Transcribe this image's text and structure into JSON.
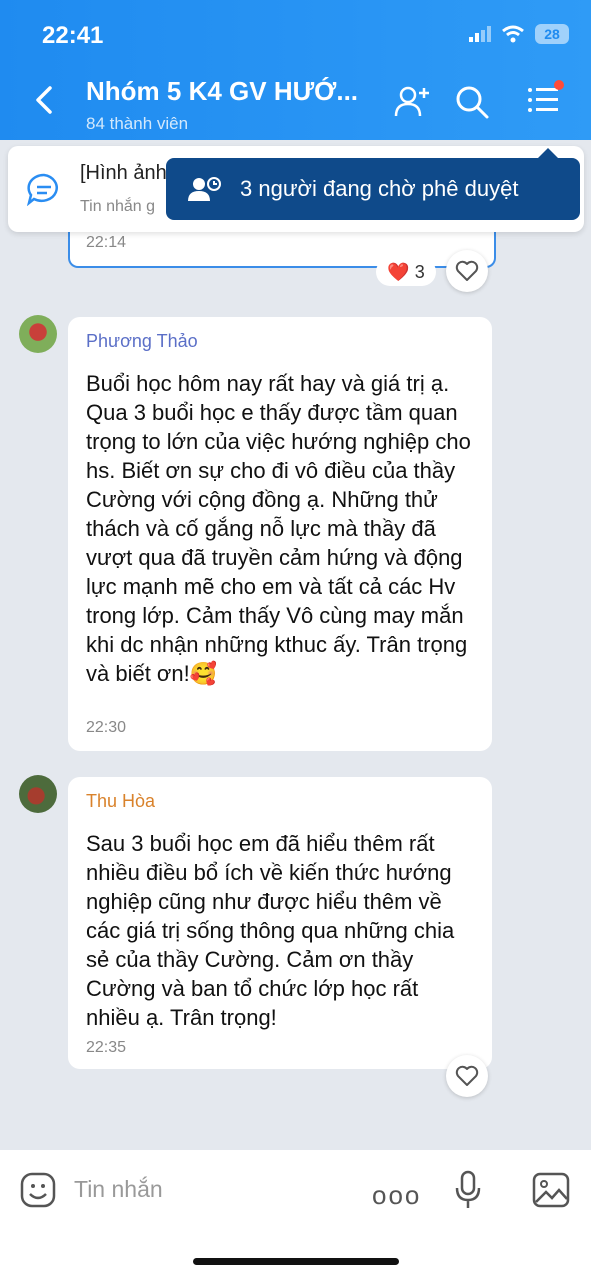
{
  "status": {
    "time": "22:41",
    "battery": "28"
  },
  "header": {
    "title": "Nhóm 5 K4 GV HƯỚ...",
    "subtitle": "84 thành viên"
  },
  "pinned": {
    "text": "[Hình ảnh]",
    "sub": "Tin nhắn g"
  },
  "tooltip": {
    "text": "3 người đang chờ phê duyệt"
  },
  "prev_message": {
    "time": "22:14",
    "reaction": "❤️",
    "reaction_count": "3"
  },
  "messages": [
    {
      "sender": "Phương Thảo",
      "sender_color": "#5b6fc7",
      "text": "Buổi học hôm nay rất hay và giá trị ạ. Qua 3 buổi học e thấy được tầm quan trọng to lớn của việc hướng nghiệp cho hs. Biết ơn sự cho đi vô điều của thầy Cường với cộng đồng ạ. Những thử thách và cố gắng nỗ lực mà thầy đã vượt qua đã truyền cảm hứng và động lực mạnh mẽ cho em và tất cả các Hv trong lớp. Cảm thấy Vô cùng may mắn khi dc nhận những kthuc ấy. Trân trọng và biết ơn!🥰",
      "time": "22:30"
    },
    {
      "sender": "Thu Hòa",
      "sender_color": "#d9822b",
      "text": "Sau 3 buổi học em đã hiểu thêm rất nhiều điều bổ ích về kiến thức hướng nghiệp cũng như được hiểu thêm về các giá trị sống thông qua những chia sẻ của thầy Cường. Cảm ơn thầy Cường và ban tổ chức lớp học rất nhiều ạ. Trân trọng!",
      "time": "22:35"
    }
  ],
  "composer": {
    "placeholder": "Tin nhắn",
    "more": "ooo"
  },
  "colors": {
    "header": "#1f8bf0",
    "tooltip": "#0f4a8a",
    "background": "#e4e8ee"
  }
}
